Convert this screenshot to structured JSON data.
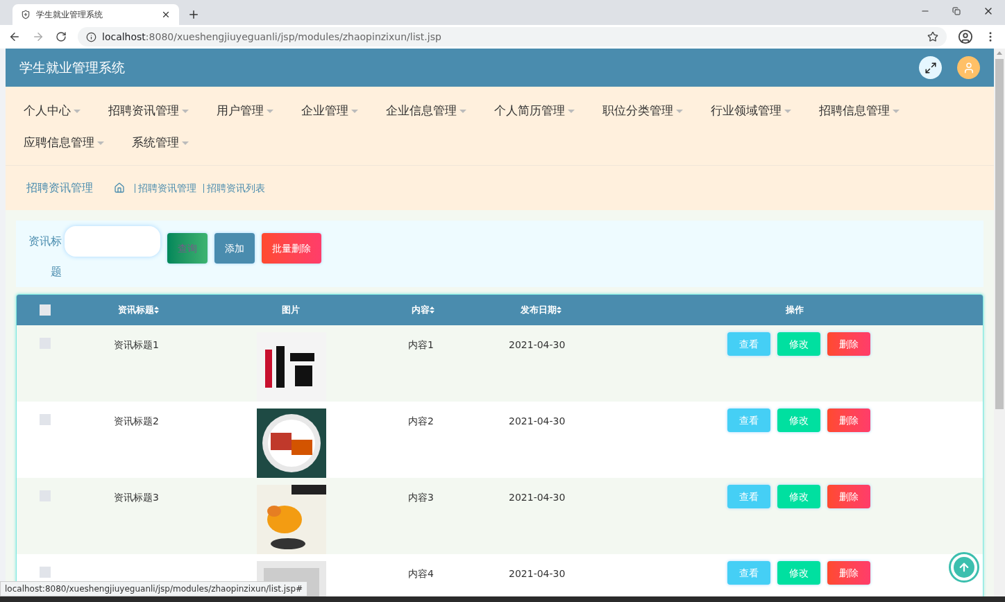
{
  "browser": {
    "tab_title": "学生就业管理系统",
    "url_host": "localhost",
    "url_path": ":8080/xueshengjiuyeguanli/jsp/modules/zhaopinzixun/list.jsp",
    "status_link": "localhost:8080/xueshengjiuyeguanli/jsp/modules/zhaopinzixun/list.jsp#"
  },
  "header": {
    "title": "学生就业管理系统"
  },
  "nav": [
    {
      "label": "个人中心"
    },
    {
      "label": "招聘资讯管理"
    },
    {
      "label": "用户管理"
    },
    {
      "label": "企业管理"
    },
    {
      "label": "企业信息管理"
    },
    {
      "label": "个人简历管理"
    },
    {
      "label": "职位分类管理"
    },
    {
      "label": "行业领域管理"
    },
    {
      "label": "招聘信息管理"
    },
    {
      "label": "应聘信息管理"
    },
    {
      "label": "系统管理"
    }
  ],
  "breadcrumb": {
    "title": "招聘资讯管理",
    "path": [
      "招聘资讯管理",
      "招聘资讯列表"
    ]
  },
  "search": {
    "label": "资讯标题",
    "buttons": [
      {
        "label": "查询",
        "kind": "search"
      },
      {
        "label": "添加",
        "kind": "add"
      },
      {
        "label": "批量删除",
        "kind": "delete"
      }
    ]
  },
  "table": {
    "columns": [
      {
        "label": "资讯标题",
        "sortable": true
      },
      {
        "label": "图片",
        "sortable": false
      },
      {
        "label": "内容",
        "sortable": true
      },
      {
        "label": "发布日期",
        "sortable": true
      },
      {
        "label": "操作",
        "sortable": false
      }
    ],
    "select_all_checked": false,
    "rows": [
      {
        "checked": false,
        "title": "资讯标题1",
        "content": "内容1",
        "date": "2021-04-30",
        "actions": [
          "查看",
          "修改",
          "删除"
        ]
      },
      {
        "checked": false,
        "title": "资讯标题2",
        "content": "内容2",
        "date": "2021-04-30",
        "actions": [
          "查看",
          "修改",
          "删除"
        ]
      },
      {
        "checked": false,
        "title": "资讯标题3",
        "content": "内容3",
        "date": "2021-04-30",
        "actions": [
          "查看",
          "修改",
          "删除"
        ]
      },
      {
        "checked": false,
        "content": "内容4",
        "date": "2021-04-30",
        "actions": [
          "查看",
          "修改",
          "删除"
        ]
      }
    ]
  }
}
